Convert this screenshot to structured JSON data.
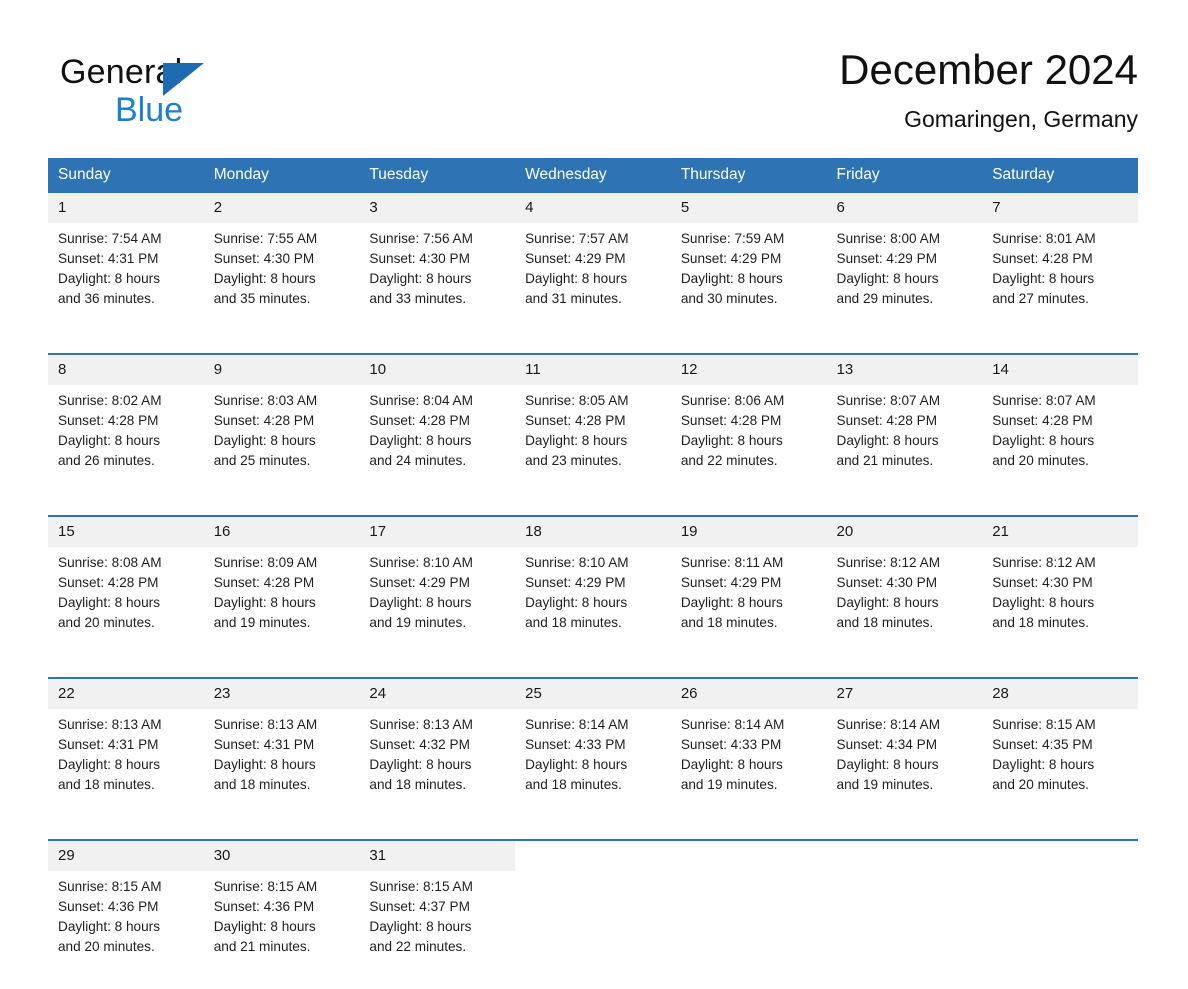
{
  "brand": {
    "line1": "General",
    "line2": "Blue",
    "triangle_icon": "triangle-icon",
    "accent_color": "#1d6cb1",
    "blue_text_color": "#1b7fd4"
  },
  "header": {
    "title": "December 2024",
    "location": "Gomaringen, Germany"
  },
  "theme": {
    "header_band": "#2e74b5",
    "daynum_band": "#f1f1f1",
    "separator": "#2e74b5",
    "text": "#1a1a1a",
    "page_background": "#ffffff"
  },
  "weekdays": [
    "Sunday",
    "Monday",
    "Tuesday",
    "Wednesday",
    "Thursday",
    "Friday",
    "Saturday"
  ],
  "weeks": [
    {
      "days": [
        {
          "date": "1",
          "sunrise": "Sunrise: 7:54 AM",
          "sunset": "Sunset: 4:31 PM",
          "daylight_1": "Daylight: 8 hours",
          "daylight_2": "and 36 minutes."
        },
        {
          "date": "2",
          "sunrise": "Sunrise: 7:55 AM",
          "sunset": "Sunset: 4:30 PM",
          "daylight_1": "Daylight: 8 hours",
          "daylight_2": "and 35 minutes."
        },
        {
          "date": "3",
          "sunrise": "Sunrise: 7:56 AM",
          "sunset": "Sunset: 4:30 PM",
          "daylight_1": "Daylight: 8 hours",
          "daylight_2": "and 33 minutes."
        },
        {
          "date": "4",
          "sunrise": "Sunrise: 7:57 AM",
          "sunset": "Sunset: 4:29 PM",
          "daylight_1": "Daylight: 8 hours",
          "daylight_2": "and 31 minutes."
        },
        {
          "date": "5",
          "sunrise": "Sunrise: 7:59 AM",
          "sunset": "Sunset: 4:29 PM",
          "daylight_1": "Daylight: 8 hours",
          "daylight_2": "and 30 minutes."
        },
        {
          "date": "6",
          "sunrise": "Sunrise: 8:00 AM",
          "sunset": "Sunset: 4:29 PM",
          "daylight_1": "Daylight: 8 hours",
          "daylight_2": "and 29 minutes."
        },
        {
          "date": "7",
          "sunrise": "Sunrise: 8:01 AM",
          "sunset": "Sunset: 4:28 PM",
          "daylight_1": "Daylight: 8 hours",
          "daylight_2": "and 27 minutes."
        }
      ]
    },
    {
      "days": [
        {
          "date": "8",
          "sunrise": "Sunrise: 8:02 AM",
          "sunset": "Sunset: 4:28 PM",
          "daylight_1": "Daylight: 8 hours",
          "daylight_2": "and 26 minutes."
        },
        {
          "date": "9",
          "sunrise": "Sunrise: 8:03 AM",
          "sunset": "Sunset: 4:28 PM",
          "daylight_1": "Daylight: 8 hours",
          "daylight_2": "and 25 minutes."
        },
        {
          "date": "10",
          "sunrise": "Sunrise: 8:04 AM",
          "sunset": "Sunset: 4:28 PM",
          "daylight_1": "Daylight: 8 hours",
          "daylight_2": "and 24 minutes."
        },
        {
          "date": "11",
          "sunrise": "Sunrise: 8:05 AM",
          "sunset": "Sunset: 4:28 PM",
          "daylight_1": "Daylight: 8 hours",
          "daylight_2": "and 23 minutes."
        },
        {
          "date": "12",
          "sunrise": "Sunrise: 8:06 AM",
          "sunset": "Sunset: 4:28 PM",
          "daylight_1": "Daylight: 8 hours",
          "daylight_2": "and 22 minutes."
        },
        {
          "date": "13",
          "sunrise": "Sunrise: 8:07 AM",
          "sunset": "Sunset: 4:28 PM",
          "daylight_1": "Daylight: 8 hours",
          "daylight_2": "and 21 minutes."
        },
        {
          "date": "14",
          "sunrise": "Sunrise: 8:07 AM",
          "sunset": "Sunset: 4:28 PM",
          "daylight_1": "Daylight: 8 hours",
          "daylight_2": "and 20 minutes."
        }
      ]
    },
    {
      "days": [
        {
          "date": "15",
          "sunrise": "Sunrise: 8:08 AM",
          "sunset": "Sunset: 4:28 PM",
          "daylight_1": "Daylight: 8 hours",
          "daylight_2": "and 20 minutes."
        },
        {
          "date": "16",
          "sunrise": "Sunrise: 8:09 AM",
          "sunset": "Sunset: 4:28 PM",
          "daylight_1": "Daylight: 8 hours",
          "daylight_2": "and 19 minutes."
        },
        {
          "date": "17",
          "sunrise": "Sunrise: 8:10 AM",
          "sunset": "Sunset: 4:29 PM",
          "daylight_1": "Daylight: 8 hours",
          "daylight_2": "and 19 minutes."
        },
        {
          "date": "18",
          "sunrise": "Sunrise: 8:10 AM",
          "sunset": "Sunset: 4:29 PM",
          "daylight_1": "Daylight: 8 hours",
          "daylight_2": "and 18 minutes."
        },
        {
          "date": "19",
          "sunrise": "Sunrise: 8:11 AM",
          "sunset": "Sunset: 4:29 PM",
          "daylight_1": "Daylight: 8 hours",
          "daylight_2": "and 18 minutes."
        },
        {
          "date": "20",
          "sunrise": "Sunrise: 8:12 AM",
          "sunset": "Sunset: 4:30 PM",
          "daylight_1": "Daylight: 8 hours",
          "daylight_2": "and 18 minutes."
        },
        {
          "date": "21",
          "sunrise": "Sunrise: 8:12 AM",
          "sunset": "Sunset: 4:30 PM",
          "daylight_1": "Daylight: 8 hours",
          "daylight_2": "and 18 minutes."
        }
      ]
    },
    {
      "days": [
        {
          "date": "22",
          "sunrise": "Sunrise: 8:13 AM",
          "sunset": "Sunset: 4:31 PM",
          "daylight_1": "Daylight: 8 hours",
          "daylight_2": "and 18 minutes."
        },
        {
          "date": "23",
          "sunrise": "Sunrise: 8:13 AM",
          "sunset": "Sunset: 4:31 PM",
          "daylight_1": "Daylight: 8 hours",
          "daylight_2": "and 18 minutes."
        },
        {
          "date": "24",
          "sunrise": "Sunrise: 8:13 AM",
          "sunset": "Sunset: 4:32 PM",
          "daylight_1": "Daylight: 8 hours",
          "daylight_2": "and 18 minutes."
        },
        {
          "date": "25",
          "sunrise": "Sunrise: 8:14 AM",
          "sunset": "Sunset: 4:33 PM",
          "daylight_1": "Daylight: 8 hours",
          "daylight_2": "and 18 minutes."
        },
        {
          "date": "26",
          "sunrise": "Sunrise: 8:14 AM",
          "sunset": "Sunset: 4:33 PM",
          "daylight_1": "Daylight: 8 hours",
          "daylight_2": "and 19 minutes."
        },
        {
          "date": "27",
          "sunrise": "Sunrise: 8:14 AM",
          "sunset": "Sunset: 4:34 PM",
          "daylight_1": "Daylight: 8 hours",
          "daylight_2": "and 19 minutes."
        },
        {
          "date": "28",
          "sunrise": "Sunrise: 8:15 AM",
          "sunset": "Sunset: 4:35 PM",
          "daylight_1": "Daylight: 8 hours",
          "daylight_2": "and 20 minutes."
        }
      ]
    },
    {
      "days": [
        {
          "date": "29",
          "sunrise": "Sunrise: 8:15 AM",
          "sunset": "Sunset: 4:36 PM",
          "daylight_1": "Daylight: 8 hours",
          "daylight_2": "and 20 minutes."
        },
        {
          "date": "30",
          "sunrise": "Sunrise: 8:15 AM",
          "sunset": "Sunset: 4:36 PM",
          "daylight_1": "Daylight: 8 hours",
          "daylight_2": "and 21 minutes."
        },
        {
          "date": "31",
          "sunrise": "Sunrise: 8:15 AM",
          "sunset": "Sunset: 4:37 PM",
          "daylight_1": "Daylight: 8 hours",
          "daylight_2": "and 22 minutes."
        },
        {
          "date": "",
          "sunrise": "",
          "sunset": "",
          "daylight_1": "",
          "daylight_2": ""
        },
        {
          "date": "",
          "sunrise": "",
          "sunset": "",
          "daylight_1": "",
          "daylight_2": ""
        },
        {
          "date": "",
          "sunrise": "",
          "sunset": "",
          "daylight_1": "",
          "daylight_2": ""
        },
        {
          "date": "",
          "sunrise": "",
          "sunset": "",
          "daylight_1": "",
          "daylight_2": ""
        }
      ]
    }
  ]
}
